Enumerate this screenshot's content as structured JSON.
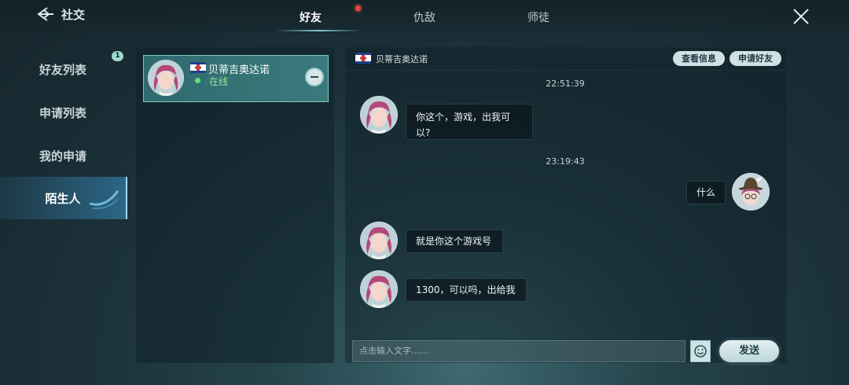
{
  "header": {
    "back_label": "社交",
    "tabs": [
      {
        "label": "好友",
        "active": true
      },
      {
        "label": "仇敌",
        "active": false
      },
      {
        "label": "师徒",
        "active": false
      }
    ]
  },
  "sidebar": {
    "items": [
      {
        "label": "好友列表",
        "badge": "1"
      },
      {
        "label": "申请列表"
      },
      {
        "label": "我的申请"
      },
      {
        "label": "陌生人",
        "active": true
      }
    ]
  },
  "friend_list": [
    {
      "name": "贝蒂吉奥达诺",
      "status": "在线"
    }
  ],
  "chat": {
    "contact_name": "贝蒂吉奥达诺",
    "view_info_label": "查看信息",
    "add_friend_label": "申请好友",
    "messages": [
      {
        "type": "time",
        "text": "22:51:39"
      },
      {
        "type": "in",
        "text": "你这个，游戏，出我可以?"
      },
      {
        "type": "time",
        "text": "23:19:43"
      },
      {
        "type": "out",
        "text": "什么"
      },
      {
        "type": "in",
        "text": "就是你这个游戏号"
      },
      {
        "type": "in",
        "text": "1300，可以吗，出给我"
      }
    ],
    "input_placeholder": "点击输入文字……",
    "send_label": "发送"
  },
  "icons": {
    "back": "back-arrow-icon",
    "close": "close-icon",
    "flag": "flag-icon",
    "emoji": "emoji-icon",
    "remove": "remove-friend-icon"
  },
  "colors": {
    "online": "#5fe07a",
    "accent": "#9fdcef",
    "card": "#3a7a7c"
  }
}
